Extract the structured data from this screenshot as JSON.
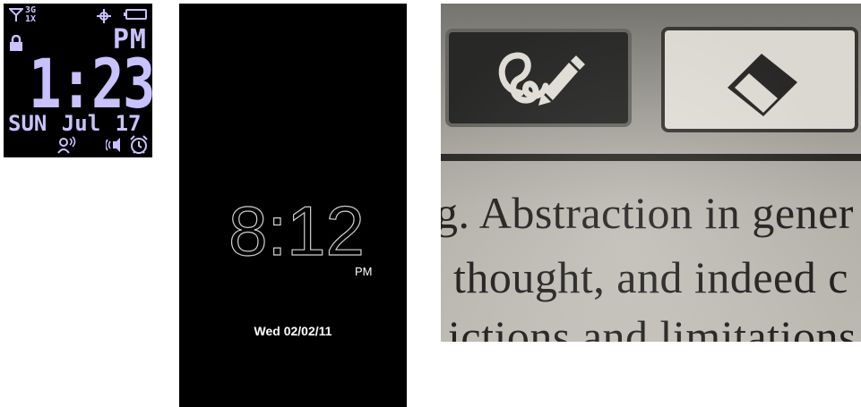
{
  "lcd_screen": {
    "network_top": "3G",
    "network_bottom": "1X",
    "ampm": "PM",
    "time": "1:23",
    "date": "SUN Jul 17",
    "icons": [
      "signal-icon",
      "gps-icon",
      "battery-icon",
      "lock-icon",
      "contact-icon",
      "speaker-icon",
      "alarm-clock-icon"
    ],
    "text_color": "#c8c2ff"
  },
  "lock_screen": {
    "time": "8:12",
    "ampm": "PM",
    "date": "Wed 02/02/11"
  },
  "ereader": {
    "tools": [
      {
        "name": "pen-tool",
        "icon": "pen-scribble-icon",
        "selected": true
      },
      {
        "name": "eraser-tool",
        "icon": "eraser-icon",
        "selected": false
      }
    ],
    "text_lines": [
      "g. Abstraction in gener",
      "thought, and indeed c",
      "ictions and limitations"
    ]
  }
}
